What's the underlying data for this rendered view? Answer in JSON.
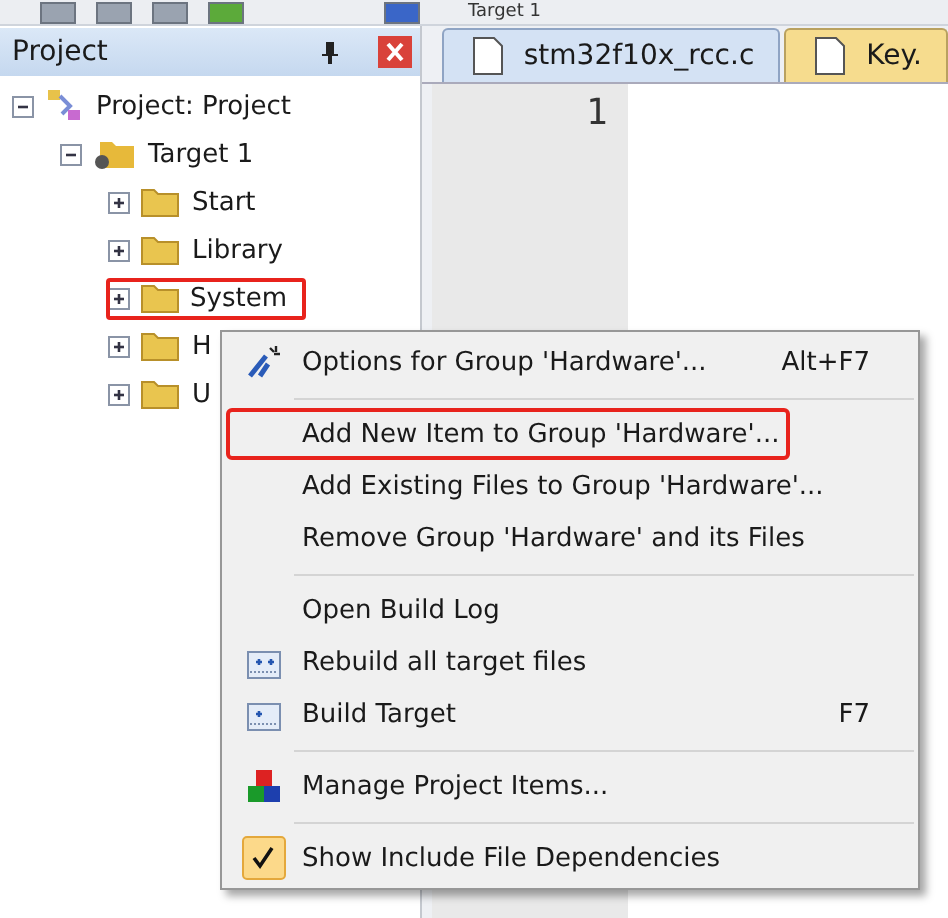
{
  "toolbar": {
    "target": "Target 1"
  },
  "project_panel": {
    "title": "Project",
    "tree": [
      {
        "label": "Project: Project",
        "kind": "project",
        "expanded": true,
        "highlighted": false,
        "children": [
          {
            "label": "Target 1",
            "kind": "target",
            "expanded": true,
            "highlighted": false,
            "children": [
              {
                "label": "Start",
                "kind": "group",
                "expanded": false,
                "highlighted": false
              },
              {
                "label": "Library",
                "kind": "group",
                "expanded": false,
                "highlighted": false
              },
              {
                "label": "System",
                "kind": "group",
                "expanded": false,
                "highlighted": true
              },
              {
                "label": "H",
                "kind": "group",
                "expanded": false,
                "highlighted": false
              },
              {
                "label": "U",
                "kind": "group",
                "expanded": false,
                "highlighted": false
              }
            ]
          }
        ]
      }
    ]
  },
  "editor": {
    "tabs": [
      {
        "label": "stm32f10x_rcc.c",
        "selected": true
      },
      {
        "label": "Key.",
        "selected": false
      }
    ],
    "line_numbers": [
      "1"
    ]
  },
  "context_menu": [
    {
      "kind": "item",
      "label": "Options for Group 'Hardware'...",
      "shortcut": "Alt+F7",
      "highlighted": false
    },
    {
      "kind": "separator"
    },
    {
      "kind": "item",
      "label": "Add New  Item to Group 'Hardware'...",
      "highlighted": true
    },
    {
      "kind": "item",
      "label": "Add Existing Files to Group 'Hardware'...",
      "highlighted": false
    },
    {
      "kind": "item",
      "label": "Remove Group 'Hardware' and its Files",
      "highlighted": false
    },
    {
      "kind": "separator"
    },
    {
      "kind": "item",
      "label": "Open Build Log",
      "highlighted": false
    },
    {
      "kind": "item",
      "label": "Rebuild all target files",
      "highlighted": false
    },
    {
      "kind": "item",
      "label": "Build Target",
      "shortcut": "F7",
      "highlighted": false
    },
    {
      "kind": "separator"
    },
    {
      "kind": "item",
      "label": "Manage Project Items...",
      "highlighted": false
    },
    {
      "kind": "separator"
    },
    {
      "kind": "check",
      "label": "Show Include File Dependencies",
      "checked": true,
      "highlighted": false
    }
  ]
}
